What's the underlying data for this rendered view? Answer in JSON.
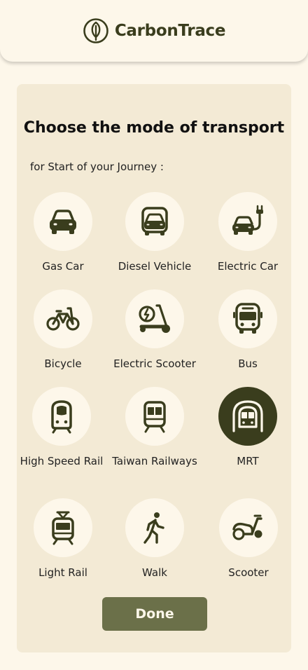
{
  "app": {
    "name": "CarbonTrace",
    "logo_icon": "leaf-icon"
  },
  "colors": {
    "accent": "#3a3d1d",
    "button": "#6b7049",
    "card": "#f3ead5",
    "background": "#fdf7ea"
  },
  "page": {
    "title": "Choose the mode of transport",
    "subtitle": "for Start of your Journey :"
  },
  "options": [
    {
      "label": "Gas Car",
      "icon": "car-icon",
      "selected": false
    },
    {
      "label": "Diesel Vehicle",
      "icon": "van-icon",
      "selected": false
    },
    {
      "label": "Electric Car",
      "icon": "electric-car-icon",
      "selected": false
    },
    {
      "label": "Bicycle",
      "icon": "bicycle-icon",
      "selected": false
    },
    {
      "label": "Electric Scooter",
      "icon": "electric-scooter-icon",
      "selected": false
    },
    {
      "label": "Bus",
      "icon": "bus-icon",
      "selected": false
    },
    {
      "label": "High Speed Rail",
      "icon": "high-speed-rail-icon",
      "selected": false
    },
    {
      "label": "Taiwan Railways",
      "icon": "train-icon",
      "selected": false
    },
    {
      "label": "MRT",
      "icon": "mrt-icon",
      "selected": true
    },
    {
      "label": "Light Rail",
      "icon": "tram-icon",
      "selected": false
    },
    {
      "label": "Walk",
      "icon": "walk-icon",
      "selected": false
    },
    {
      "label": "Scooter",
      "icon": "scooter-icon",
      "selected": false
    }
  ],
  "done_label": "Done"
}
